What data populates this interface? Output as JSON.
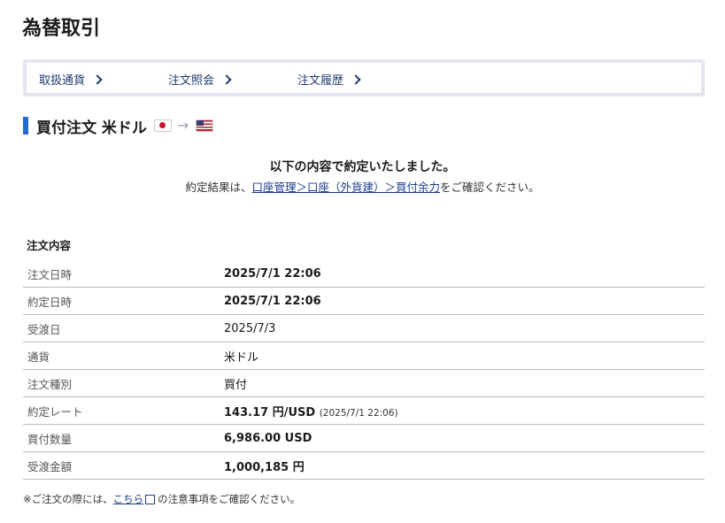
{
  "page": {
    "title": "為替取引"
  },
  "subnav": {
    "items": [
      {
        "label": "取扱通貨"
      },
      {
        "label": "注文照会"
      },
      {
        "label": "注文履歴"
      }
    ]
  },
  "section": {
    "title": "買付注文 米ドル",
    "from_flag": "jp-flag-icon",
    "to_flag": "us-flag-icon",
    "arrow": "→"
  },
  "confirmation": {
    "main": "以下の内容で約定いたしました。",
    "sub_prefix": "約定結果は、",
    "sub_link": "口座管理＞口座（外貨建）＞買付余力",
    "sub_suffix": "をご確認ください。"
  },
  "details": {
    "heading": "注文内容",
    "rows": [
      {
        "label": "注文日時",
        "value": "2025/7/1 22:06"
      },
      {
        "label": "約定日時",
        "value": "2025/7/1 22:06"
      },
      {
        "label": "受渡日",
        "value": "2025/7/3"
      },
      {
        "label": "通貨",
        "value": "米ドル"
      },
      {
        "label": "注文種別",
        "value": "買付"
      },
      {
        "label": "約定レート",
        "value": "143.17 円/USD",
        "extra": "(2025/7/1 22:06)"
      },
      {
        "label": "買付数量",
        "value": "6,986.00 USD"
      },
      {
        "label": "受渡金額",
        "value": "1,000,185 円"
      }
    ]
  },
  "note": {
    "prefix": "※ご注文の際には、",
    "link": "こちら",
    "suffix": "の注意事項をご確認ください。"
  }
}
